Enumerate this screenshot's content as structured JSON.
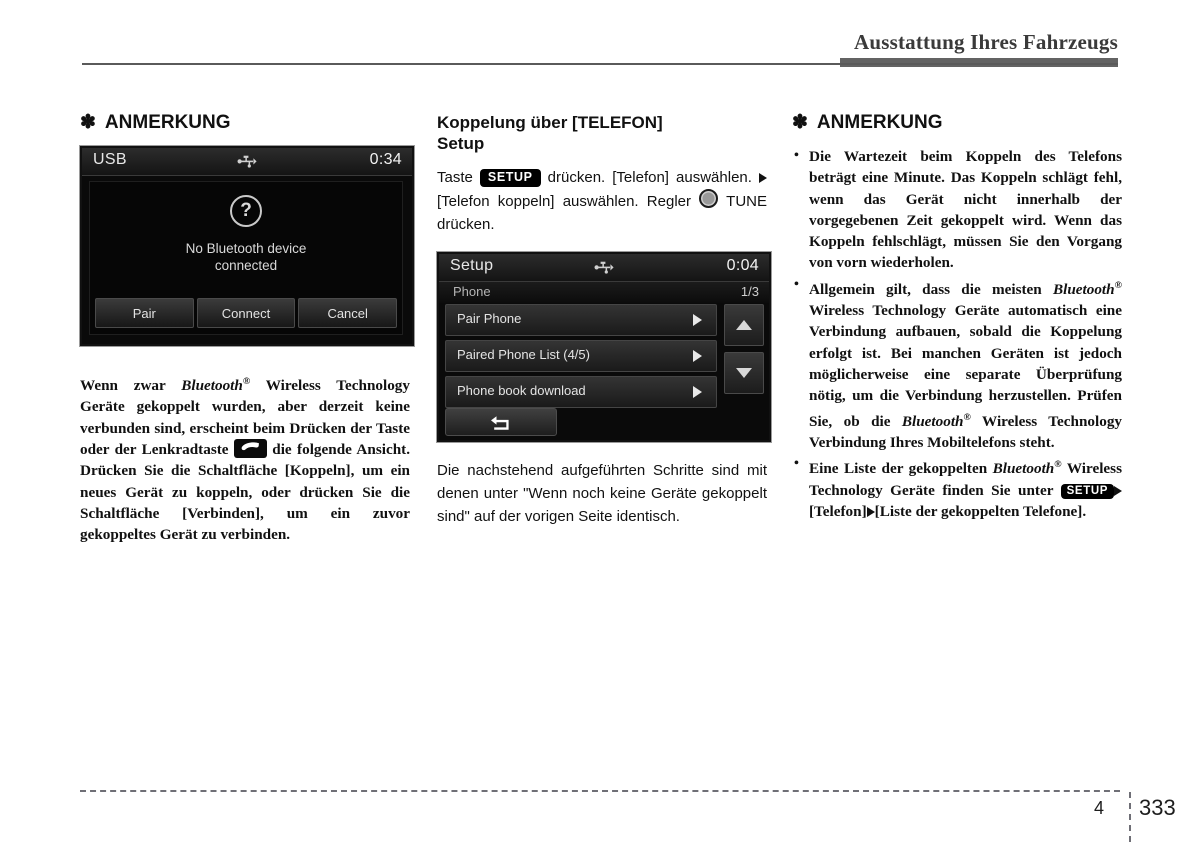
{
  "header": {
    "title": "Ausstattung Ihres Fahrzeugs"
  },
  "footer": {
    "chapter": "4",
    "page": "333"
  },
  "left_column": {
    "note_star": "✽",
    "note_title": "ANMERKUNG",
    "screen": {
      "source_label": "USB",
      "usb_icon": "usb-icon",
      "clock": "0:34",
      "dialog_icon": "question-mark-icon",
      "dialog_icon_glyph": "?",
      "message_line1": "No Bluetooth device",
      "message_line2": "connected",
      "buttons": [
        "Pair",
        "Connect",
        "Cancel"
      ]
    },
    "body_part1": "Wenn zwar ",
    "body_bluetooth": "Bluetooth",
    "body_reg": "®",
    "body_part2": " Wireless Technology Geräte gekoppelt wurden, aber derzeit keine verbunden sind, erscheint beim Drücken der Taste oder der Lenkradtaste ",
    "body_phone_icon": "phone-call-key-icon",
    "body_part3": " die folgende Ansicht. Drücken Sie die Schaltfläche [Koppeln], um ein neues Gerät zu koppeln, oder drücken Sie die Schaltfläche [Verbinden], um ein zuvor gekoppeltes Gerät zu verbinden."
  },
  "middle_column": {
    "heading_line1": "Koppelung über [TELEFON]",
    "heading_line2": "Setup",
    "step_part1": "Taste ",
    "step_setup_badge": "SETUP",
    "step_part2": " drücken. [Telefon] auswählen. ",
    "step_arrow": "▶",
    "step_part3": "[Telefon koppeln] auswählen. Regler ",
    "step_knob_icon": "tune-knob-icon",
    "step_part4": " TUNE drücken.",
    "screen": {
      "title": "Setup",
      "usb_icon": "usb-icon",
      "clock": "0:04",
      "subtitle": "Phone",
      "page_indicator": "1/3",
      "rows": [
        "Pair Phone",
        "Paired Phone List  (4/5)",
        "Phone book download"
      ],
      "scroll_up": "▲",
      "scroll_down": "▼",
      "back_button": "back-arrow-icon"
    },
    "caption": "Die nachstehend aufgeführten Schritte sind mit denen unter \"Wenn noch keine Geräte gekoppelt sind\" auf der vorigen Seite identisch."
  },
  "right_column": {
    "note_star": "✽",
    "note_title": "ANMERKUNG",
    "bullets": [
      {
        "id": "bullet-wartezeit",
        "text": "Die Wartezeit beim Koppeln des Telefons beträgt eine Minute. Das Koppeln schlägt fehl, wenn das Gerät nicht innerhalb der vorgegebenen Zeit gekoppelt wird. Wenn das Koppeln fehlschlägt, müssen Sie den Vorgang von vorn wiederholen."
      },
      {
        "id": "bullet-allgemein",
        "part1": "Allgemein gilt, dass die meisten ",
        "bt1": "Bluetooth",
        "reg1": "®",
        "part2": " Wireless Technology Geräte automatisch eine Verbindung aufbauen, sobald die Koppelung erfolgt ist. Bei manchen Geräten ist jedoch möglicherweise eine separate Überprüfung nötig, um die Verbindung herzustellen. Prüfen Sie, ob die ",
        "bt2": "Bluetooth",
        "reg2": "®",
        "part3": " Wireless Technology Verbindung Ihres Mobiltelefons steht."
      },
      {
        "id": "bullet-liste",
        "part1": "Eine Liste der gekoppelten ",
        "bt1": "Bluetooth",
        "reg1": "®",
        "part2": " Wireless Technology Geräte finden Sie unter ",
        "setup_badge": "SETUP",
        "arrow1": "▶",
        "part3": "[Telefon]",
        "arrow2": "▶",
        "part4": "[Liste der gekoppelten Telefone]."
      }
    ]
  }
}
